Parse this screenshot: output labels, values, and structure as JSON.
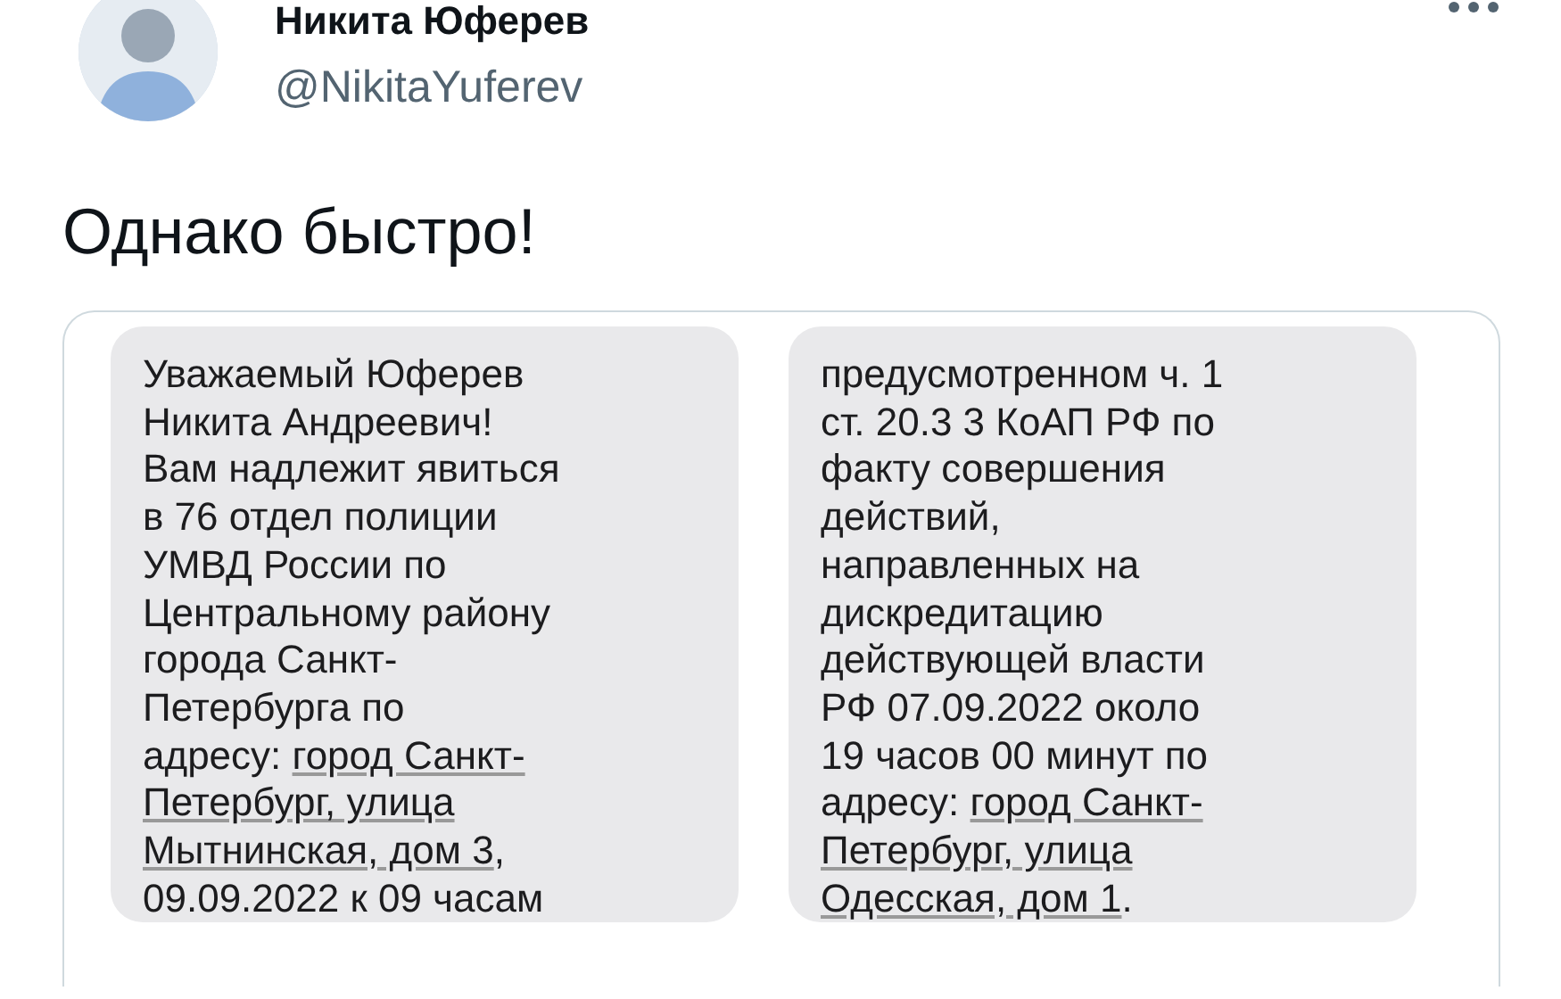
{
  "author": {
    "name": "Никита Юферев",
    "handle": "@NikitaYuferev"
  },
  "tweet_text": "Однако быстро!",
  "images": [
    {
      "messages": [
        {
          "lines": [
            [
              {
                "kind": "text",
                "text": "Уважаемый Юферев"
              }
            ],
            [
              {
                "kind": "text",
                "text": "Никита Андреевич!"
              }
            ],
            [
              {
                "kind": "text",
                "text": "Вам надлежит явиться"
              }
            ],
            [
              {
                "kind": "text",
                "text": "в 76 отдел полиции"
              }
            ],
            [
              {
                "kind": "text",
                "text": "УМВД России по"
              }
            ],
            [
              {
                "kind": "text",
                "text": "Центральному району"
              }
            ],
            [
              {
                "kind": "text",
                "text": "города Санкт-"
              }
            ],
            [
              {
                "kind": "text",
                "text": "Петербурга по"
              }
            ],
            [
              {
                "kind": "text",
                "text": "адресу: "
              },
              {
                "kind": "link",
                "text": "город Санкт-"
              }
            ],
            [
              {
                "kind": "link",
                "text": "Петербург, улица"
              }
            ],
            [
              {
                "kind": "link",
                "text": "Мытнинская, дом 3"
              },
              {
                "kind": "text",
                "text": ","
              }
            ],
            [
              {
                "kind": "text",
                "text": "09.09.2022 к 09 часам"
              }
            ]
          ]
        }
      ]
    },
    {
      "messages": [
        {
          "lines": [
            [
              {
                "kind": "text",
                "text": "предусмотренном ч. 1"
              }
            ],
            [
              {
                "kind": "text",
                "text": "ст. 20.3 3 КоАП РФ по"
              }
            ],
            [
              {
                "kind": "text",
                "text": "факту совершения"
              }
            ],
            [
              {
                "kind": "text",
                "text": "действий,"
              }
            ],
            [
              {
                "kind": "text",
                "text": "направленных на"
              }
            ],
            [
              {
                "kind": "text",
                "text": "дискредитацию"
              }
            ],
            [
              {
                "kind": "text",
                "text": "действующей власти"
              }
            ],
            [
              {
                "kind": "text",
                "text": "РФ 07.09.2022 около"
              }
            ],
            [
              {
                "kind": "text",
                "text": "19 часов 00 минут по"
              }
            ],
            [
              {
                "kind": "text",
                "text": "адресу: "
              },
              {
                "kind": "link",
                "text": "город Санкт-"
              }
            ],
            [
              {
                "kind": "link",
                "text": "Петербург, улица"
              }
            ],
            [
              {
                "kind": "link",
                "text": "Одесская, дом 1"
              },
              {
                "kind": "text",
                "text": "."
              }
            ]
          ]
        }
      ]
    }
  ]
}
